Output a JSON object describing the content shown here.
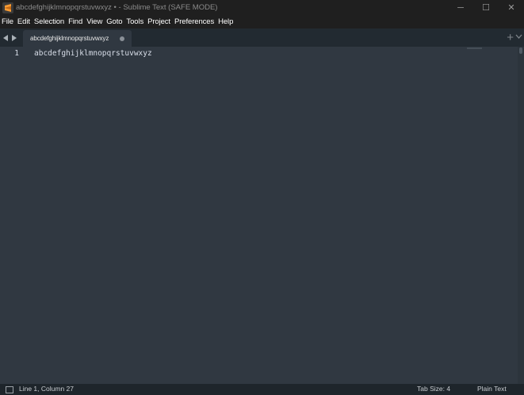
{
  "window": {
    "title": "abcdefghijklmnopqrstuvwxyz • - Sublime Text (SAFE MODE)",
    "controls": {
      "minimize": "─",
      "maximize": "☐",
      "close": "✕"
    }
  },
  "menu": {
    "items": [
      "File",
      "Edit",
      "Selection",
      "Find",
      "View",
      "Goto",
      "Tools",
      "Project",
      "Preferences",
      "Help"
    ]
  },
  "tabs": {
    "nav_left": "◀",
    "nav_right": "▶",
    "active_tab_label": "abcdefghijklmnopqrstuvwxyz",
    "new_tab": "+"
  },
  "editor": {
    "line_number": "1",
    "line_text": "abcdefghijklmnopqrstuvwxyz"
  },
  "status": {
    "position": "Line 1, Column 27",
    "tab_size": "Tab Size: 4",
    "syntax": "Plain Text"
  },
  "colors": {
    "editor_bg": "#303841",
    "titlebar_bg": "#1f1f1f",
    "tabbar_bg": "#222a31",
    "statusbar_bg": "#1e252b",
    "text": "#d8dee9",
    "app_icon": "#f79a32"
  },
  "icons": [
    "sublime-app-icon",
    "minimize-icon",
    "maximize-icon",
    "close-icon",
    "nav-left-icon",
    "nav-right-icon",
    "dirty-dot-icon",
    "plus-icon",
    "chevron-down-icon",
    "panel-toggle-icon"
  ]
}
